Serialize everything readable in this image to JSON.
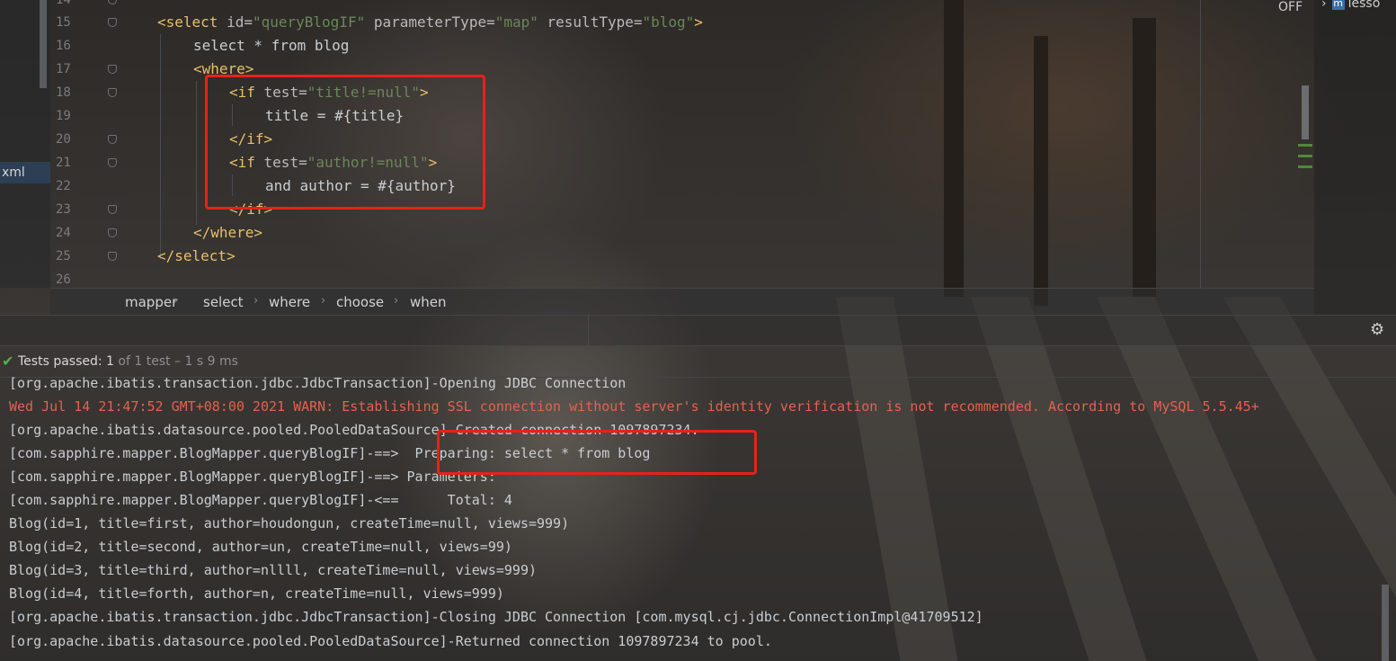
{
  "editor": {
    "tab_label": "xml",
    "right_status": "OFF",
    "project_label": "lesso",
    "lines": [
      {
        "num": "14",
        "text": ""
      },
      {
        "num": "15",
        "text": "<select id=\"queryBlogIF\" parameterType=\"map\" resultType=\"blog\">"
      },
      {
        "num": "16",
        "text": "select * from blog"
      },
      {
        "num": "17",
        "text": "<where>"
      },
      {
        "num": "18",
        "text": "<if test=\"title!=null\">"
      },
      {
        "num": "19",
        "text": "title = #{title}"
      },
      {
        "num": "20",
        "text": "</if>"
      },
      {
        "num": "21",
        "text": "<if test=\"author!=null\">"
      },
      {
        "num": "22",
        "text": "and author = #{author}"
      },
      {
        "num": "23",
        "text": "</if>"
      },
      {
        "num": "24",
        "text": "</where>"
      },
      {
        "num": "25",
        "text": "</select>"
      },
      {
        "num": "26",
        "text": ""
      }
    ]
  },
  "breadcrumb": [
    "mapper",
    "select",
    "where",
    "choose",
    "when"
  ],
  "run_panel": {
    "status_label": "Tests passed:",
    "passed_count": "1",
    "summary": "of 1 test – 1 s 9 ms"
  },
  "console": [
    {
      "text": "[org.apache.ibatis.transaction.jdbc.JdbcTransaction]-Opening JDBC Connection",
      "level": "info"
    },
    {
      "text": "Wed Jul 14 21:47:52 GMT+08:00 2021 WARN: Establishing SSL connection without server's identity verification is not recommended. According to MySQL 5.5.45+",
      "level": "warn"
    },
    {
      "text": "[org.apache.ibatis.datasource.pooled.PooledDataSource]-Created connection 1097897234.",
      "level": "info"
    },
    {
      "text": "[com.sapphire.mapper.BlogMapper.queryBlogIF]-==>  Preparing: select * from blog",
      "level": "info"
    },
    {
      "text": "[com.sapphire.mapper.BlogMapper.queryBlogIF]-==> Parameters: ",
      "level": "info"
    },
    {
      "text": "[com.sapphire.mapper.BlogMapper.queryBlogIF]-<==      Total: 4",
      "level": "info"
    },
    {
      "text": "Blog(id=1, title=first, author=houdongun, createTime=null, views=999)",
      "level": "info"
    },
    {
      "text": "Blog(id=2, title=second, author=un, createTime=null, views=99)",
      "level": "info"
    },
    {
      "text": "Blog(id=3, title=third, author=nllll, createTime=null, views=999)",
      "level": "info"
    },
    {
      "text": "Blog(id=4, title=forth, author=n, createTime=null, views=999)",
      "level": "info"
    },
    {
      "text": "[org.apache.ibatis.transaction.jdbc.JdbcTransaction]-Closing JDBC Connection [com.mysql.cj.jdbc.ConnectionImpl@41709512]",
      "level": "info"
    },
    {
      "text": "[org.apache.ibatis.datasource.pooled.PooledDataSource]-Returned connection 1097897234 to pool.",
      "level": "info"
    }
  ],
  "colors": {
    "highlight_box": "#e8211a",
    "tag": "#e8bf6a",
    "attr_value": "#6a8759",
    "warn_text": "#e8604f",
    "pass_check": "#4fb34a"
  },
  "icons": [
    "check-icon",
    "gear-icon",
    "fold-marker-icon",
    "module-icon",
    "chevron-right-icon"
  ]
}
